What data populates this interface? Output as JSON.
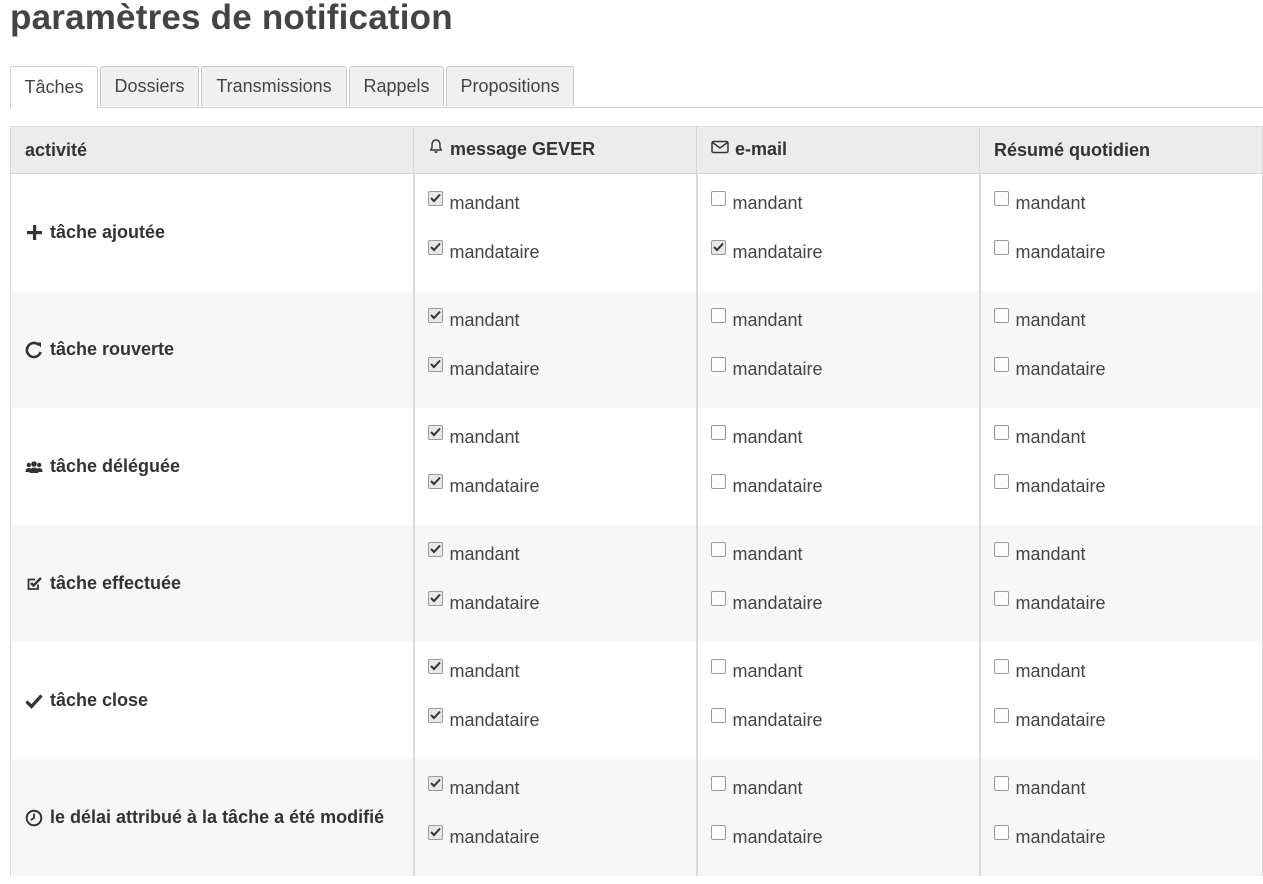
{
  "page_title": "paramètres de notification",
  "tabs": [
    {
      "label": "Tâches",
      "active": true
    },
    {
      "label": "Dossiers",
      "active": false
    },
    {
      "label": "Transmissions",
      "active": false
    },
    {
      "label": "Rappels",
      "active": false
    },
    {
      "label": "Propositions",
      "active": false
    }
  ],
  "table": {
    "headers": {
      "activity": "activité",
      "gever": "message GEVER",
      "email": "e-mail",
      "digest": "Résumé quotidien"
    },
    "header_icons": {
      "gever": "bell-icon",
      "email": "envelope-icon"
    },
    "option_labels": {
      "first": "mandant",
      "second": "mandataire"
    },
    "rows": [
      {
        "activity": "tâche ajoutée",
        "icon": "plus-icon",
        "gever": {
          "mandant": true,
          "mandataire": true
        },
        "email": {
          "mandant": false,
          "mandataire": true
        },
        "digest": {
          "mandant": false,
          "mandataire": false
        }
      },
      {
        "activity": "tâche rouverte",
        "icon": "refresh-icon",
        "gever": {
          "mandant": true,
          "mandataire": true
        },
        "email": {
          "mandant": false,
          "mandataire": false
        },
        "digest": {
          "mandant": false,
          "mandataire": false
        }
      },
      {
        "activity": "tâche déléguée",
        "icon": "users-icon",
        "gever": {
          "mandant": true,
          "mandataire": true
        },
        "email": {
          "mandant": false,
          "mandataire": false
        },
        "digest": {
          "mandant": false,
          "mandataire": false
        }
      },
      {
        "activity": "tâche effectuée",
        "icon": "checkbox-edit-icon",
        "gever": {
          "mandant": true,
          "mandataire": true
        },
        "email": {
          "mandant": false,
          "mandataire": false
        },
        "digest": {
          "mandant": false,
          "mandataire": false
        }
      },
      {
        "activity": "tâche close",
        "icon": "checkmark-icon",
        "gever": {
          "mandant": true,
          "mandataire": true
        },
        "email": {
          "mandant": false,
          "mandataire": false
        },
        "digest": {
          "mandant": false,
          "mandataire": false
        }
      },
      {
        "activity": "le délai attribué à la tâche a été modifié",
        "icon": "clock-icon",
        "gever": {
          "mandant": true,
          "mandataire": true
        },
        "email": {
          "mandant": false,
          "mandataire": false
        },
        "digest": {
          "mandant": false,
          "mandataire": false
        }
      }
    ]
  }
}
